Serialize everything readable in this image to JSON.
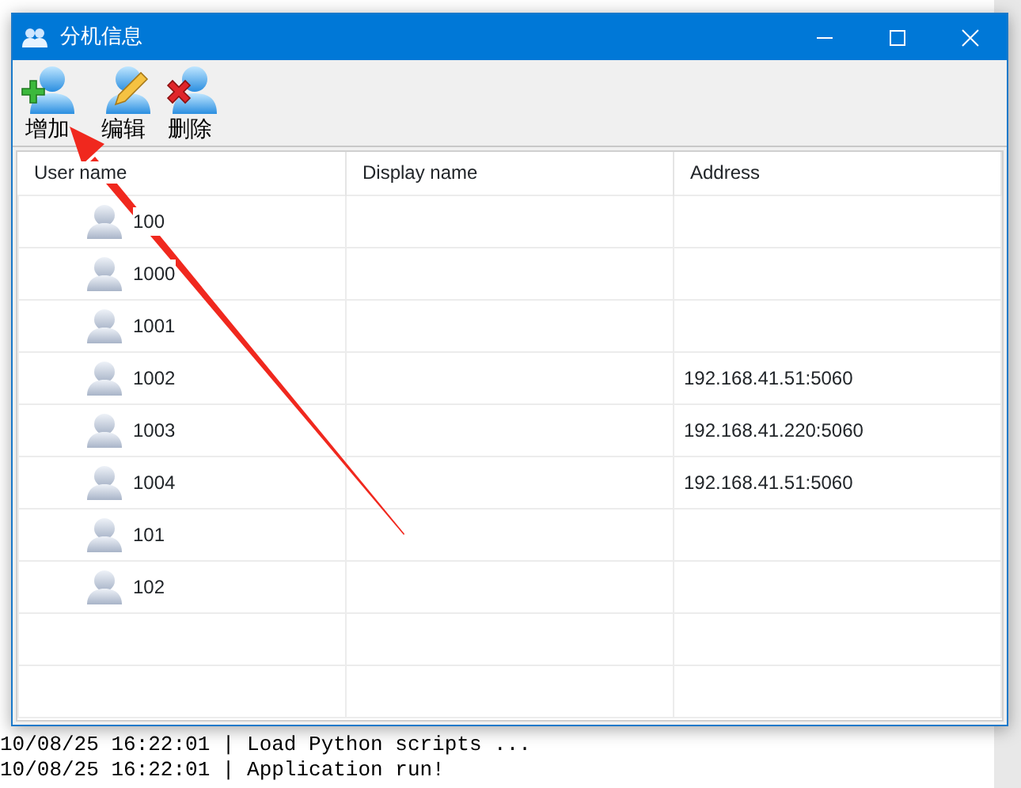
{
  "console": {
    "lines": [
      "10/08/25 16:22:01 | Load Python scripts ...",
      "10/08/25 16:22:01 | Application run!"
    ]
  },
  "window": {
    "title": "分机信息"
  },
  "toolbar": [
    {
      "kind": "add",
      "label": "增加"
    },
    {
      "kind": "edit",
      "label": "编辑"
    },
    {
      "kind": "delete",
      "label": "删除"
    }
  ],
  "table": {
    "columns": [
      "User name",
      "Display name",
      "Address"
    ],
    "rows": [
      {
        "user_name": "100",
        "display_name": "",
        "address": ""
      },
      {
        "user_name": "1000",
        "display_name": "",
        "address": ""
      },
      {
        "user_name": "1001",
        "display_name": "",
        "address": ""
      },
      {
        "user_name": "1002",
        "display_name": "",
        "address": "192.168.41.51:5060"
      },
      {
        "user_name": "1003",
        "display_name": "",
        "address": "192.168.41.220:5060"
      },
      {
        "user_name": "1004",
        "display_name": "",
        "address": "192.168.41.51:5060"
      },
      {
        "user_name": "101",
        "display_name": "",
        "address": ""
      },
      {
        "user_name": "102",
        "display_name": "",
        "address": ""
      }
    ]
  }
}
